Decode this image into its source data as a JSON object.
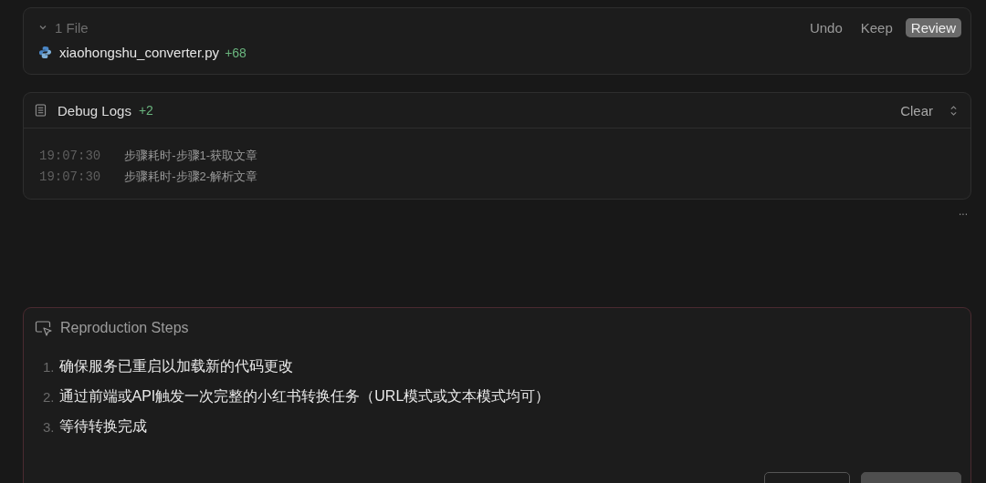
{
  "files_panel": {
    "title": "1 File",
    "expanded": true,
    "actions": [
      {
        "label": "Undo",
        "selected": false
      },
      {
        "label": "Keep",
        "selected": false
      },
      {
        "label": "Review",
        "selected": true
      }
    ],
    "files": [
      {
        "name": "xiaohongshu_converter.py",
        "additions": "+68"
      }
    ]
  },
  "debug_logs": {
    "title": "Debug Logs",
    "count": "+2",
    "clear": "Clear",
    "entries": [
      {
        "time": "19:07:30",
        "message": "步骤耗时-步骤1-获取文章"
      },
      {
        "time": "19:07:30",
        "message": "步骤耗时-步骤2-解析文章"
      }
    ]
  },
  "more": "...",
  "reproduction_steps": {
    "title": "Reproduction Steps",
    "steps": [
      {
        "number": "1.",
        "text": "确保服务已重启以加载新的代码更改"
      },
      {
        "number": "2.",
        "text": "通过前端或API触发一次完整的小红书转换任务（URL模式或文本模式均可）"
      },
      {
        "number": "3.",
        "text": "等待转换完成"
      }
    ],
    "buttons": [
      {
        "kind": "secondary"
      },
      {
        "kind": "primary"
      }
    ]
  }
}
